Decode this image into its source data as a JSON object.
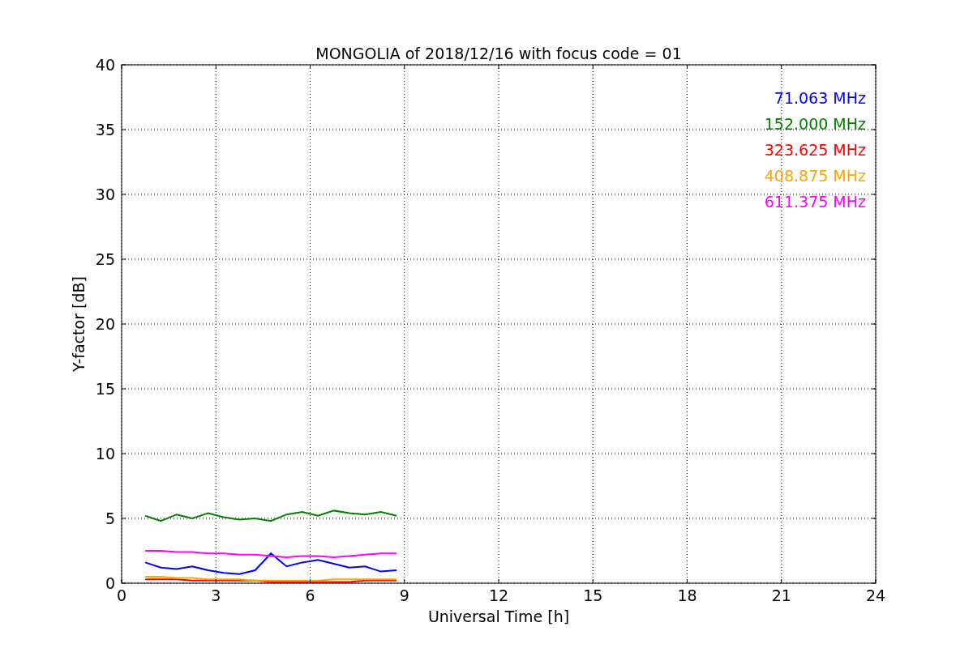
{
  "chart_data": {
    "type": "line",
    "title": "MONGOLIA of 2018/12/16 with focus code = 01",
    "xlabel": "Universal Time [h]",
    "ylabel": "Y-factor [dB]",
    "x": [
      0.75,
      1.25,
      1.75,
      2.25,
      2.75,
      3.25,
      3.75,
      4.25,
      4.75,
      5.25,
      5.75,
      6.25,
      6.75,
      7.25,
      7.75,
      8.25,
      8.75
    ],
    "series": [
      {
        "name": "71.063 MHz",
        "color": "#0000ff",
        "values": [
          1.6,
          1.2,
          1.1,
          1.3,
          1.0,
          0.8,
          0.7,
          1.0,
          2.3,
          1.3,
          1.6,
          1.8,
          1.5,
          1.2,
          1.3,
          0.9,
          1.0
        ]
      },
      {
        "name": "152.000 MHz",
        "color": "#008000",
        "values": [
          5.2,
          4.8,
          5.3,
          5.0,
          5.4,
          5.1,
          4.9,
          5.0,
          4.8,
          5.3,
          5.5,
          5.2,
          5.6,
          5.4,
          5.3,
          5.5,
          5.2
        ]
      },
      {
        "name": "323.625 MHz",
        "color": "#ff0000",
        "values": [
          0.3,
          0.3,
          0.3,
          0.2,
          0.2,
          0.2,
          0.2,
          0.2,
          0.1,
          0.1,
          0.1,
          0.1,
          0.1,
          0.1,
          0.2,
          0.2,
          0.2
        ]
      },
      {
        "name": "408.875 MHz",
        "color": "#ffa500",
        "values": [
          0.5,
          0.5,
          0.4,
          0.4,
          0.3,
          0.3,
          0.3,
          0.2,
          0.2,
          0.2,
          0.2,
          0.2,
          0.3,
          0.3,
          0.3,
          0.3,
          0.3
        ]
      },
      {
        "name": "611.375 MHz",
        "color": "#ff00ff",
        "values": [
          2.5,
          2.5,
          2.4,
          2.4,
          2.3,
          2.3,
          2.2,
          2.2,
          2.1,
          2.0,
          2.1,
          2.1,
          2.0,
          2.1,
          2.2,
          2.3,
          2.3
        ]
      }
    ],
    "xlim": [
      0,
      24
    ],
    "ylim": [
      0,
      40
    ],
    "xticks": [
      0,
      3,
      6,
      9,
      12,
      15,
      18,
      21,
      24
    ],
    "yticks": [
      0,
      5,
      10,
      15,
      20,
      25,
      30,
      35,
      40
    ],
    "grid": true
  }
}
